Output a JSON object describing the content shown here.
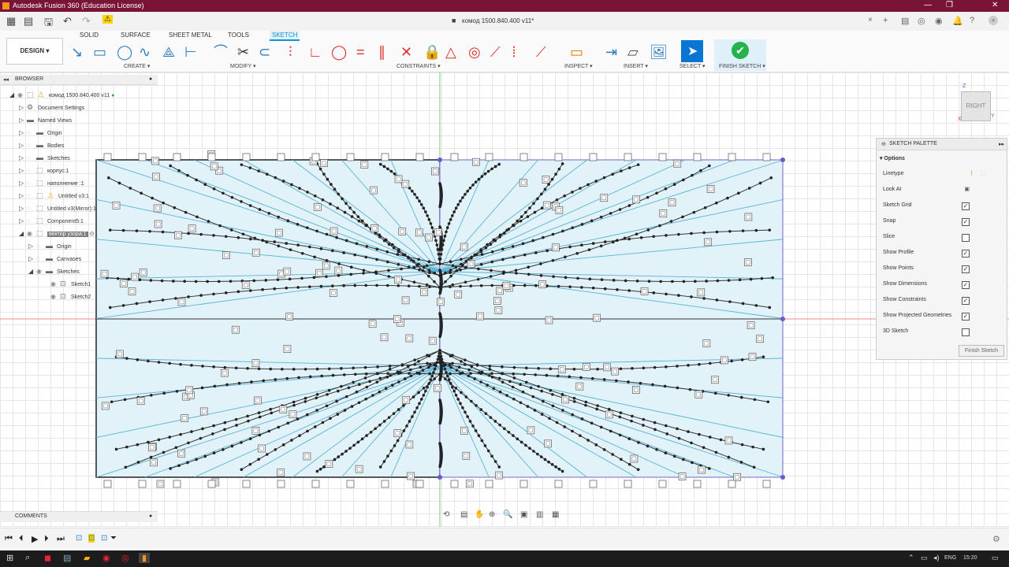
{
  "titlebar": {
    "app_title": "Autodesk Fusion 360 (Education License)",
    "minimize": "—",
    "restore": "❐",
    "close": "✕"
  },
  "doc": {
    "title": "комод 1500.840.400 v11*",
    "close": "×"
  },
  "ribbon": {
    "workspace": "DESIGN",
    "tabs": [
      "SOLID",
      "SURFACE",
      "SHEET METAL",
      "TOOLS",
      "SKETCH"
    ],
    "active_tab": "SKETCH",
    "groups": {
      "create": "CREATE ▾",
      "modify": "MODIFY ▾",
      "constraints": "CONSTRAINTS ▾",
      "inspect": "INSPECT ▾",
      "insert": "INSERT ▾",
      "select": "SELECT ▾",
      "finish": "FINISH SKETCH ▾"
    }
  },
  "browser": {
    "title": "BROWSER",
    "items": [
      {
        "label": "комод 1500.840.400 v11"
      },
      {
        "label": "Document Settings"
      },
      {
        "label": "Named Views"
      },
      {
        "label": "Origin"
      },
      {
        "label": "Bodies"
      },
      {
        "label": "Sketches"
      },
      {
        "label": "корпус:1"
      },
      {
        "label": "наполнение :1"
      },
      {
        "label": "Untitled v3:1"
      },
      {
        "label": "Untitled v3(Mirror):1"
      },
      {
        "label": "Component5:1"
      },
      {
        "label": "вектор узора:1"
      },
      {
        "label": "Origin"
      },
      {
        "label": "Canvases"
      },
      {
        "label": "Sketches"
      },
      {
        "label": "Sketch1"
      },
      {
        "label": "Sketch2"
      }
    ]
  },
  "palette": {
    "title": "SKETCH PALETTE",
    "section": "Options",
    "options": [
      {
        "label": "Linetype",
        "kind": "icon"
      },
      {
        "label": "Look At",
        "kind": "icon"
      },
      {
        "label": "Sketch Grid",
        "checked": true
      },
      {
        "label": "Snap",
        "checked": true
      },
      {
        "label": "Slice",
        "checked": false
      },
      {
        "label": "Show Profile",
        "checked": true
      },
      {
        "label": "Show Points",
        "checked": true
      },
      {
        "label": "Show Dimensions",
        "checked": true
      },
      {
        "label": "Show Constraints",
        "checked": true
      },
      {
        "label": "Show Projected Geometries",
        "checked": true
      },
      {
        "label": "3D Sketch",
        "checked": false
      }
    ],
    "finish_button": "Finish Sketch"
  },
  "comments": {
    "title": "COMMENTS"
  },
  "viewcube": {
    "face": "RIGHT",
    "axis_z": "Z",
    "axis_y": "Y",
    "axis_x": "X"
  },
  "taskbar": {
    "lang": "ENG",
    "time": "15:20"
  },
  "colors": {
    "titlebar": "#7a1437",
    "accent": "#0696d7",
    "sketch_fill": "#e2f2f9",
    "sketch_line": "#56b4d8",
    "point": "#222222",
    "finish_green": "#27b34c"
  }
}
